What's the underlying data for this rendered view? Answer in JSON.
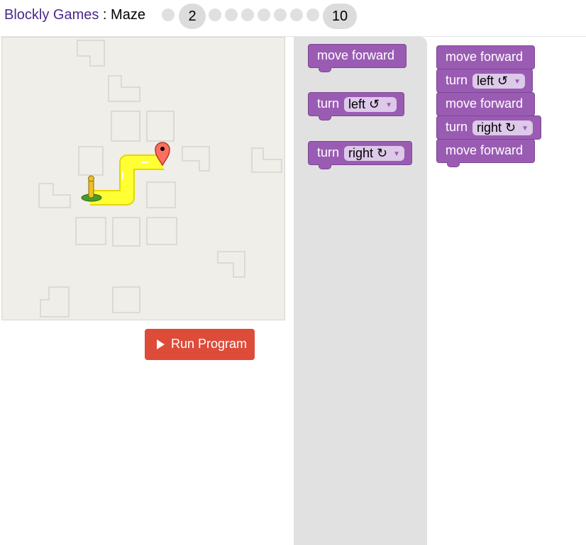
{
  "header": {
    "app_link": "Blockly Games",
    "separator": " : ",
    "game_name": "Maze",
    "current_level": "2",
    "last_level": "10"
  },
  "run_button": {
    "label": "Run Program"
  },
  "toolbox": {
    "move_forward": "move forward",
    "turn_left": {
      "label": "turn",
      "value": "left ↺"
    },
    "turn_right": {
      "label": "turn",
      "value": "right ↻"
    }
  },
  "workspace": {
    "block1": "move forward",
    "block2": {
      "label": "turn",
      "value": "left ↺"
    },
    "block3": "move forward",
    "block4": {
      "label": "turn",
      "value": "right ↻"
    },
    "block5": "move forward"
  },
  "colors": {
    "block": "#9a5cb3",
    "path": "#ffff33",
    "run": "#dd4b39",
    "link": "#4a2a8a"
  }
}
